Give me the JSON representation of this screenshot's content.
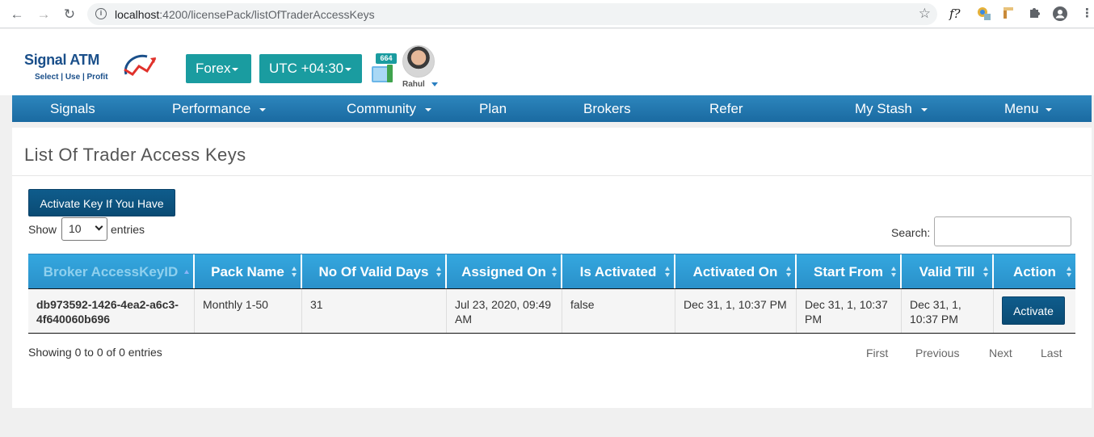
{
  "browser": {
    "url_host": "localhost",
    "url_rest": ":4200/licensePack/listOfTraderAccessKeys",
    "ext_font_label": "f?"
  },
  "brand": {
    "name_part1": "Signal",
    "name_part2": "ATM",
    "tagline": "Select | Use | Profit"
  },
  "header": {
    "market_label": "Forex",
    "timezone_label": "UTC +04:30",
    "coins_count": "664",
    "user_name": "Rahul"
  },
  "nav": {
    "items": [
      {
        "label": "Signals",
        "dropdown": false
      },
      {
        "label": "Performance",
        "dropdown": true
      },
      {
        "label": "Community",
        "dropdown": true
      },
      {
        "label": "Plan",
        "dropdown": false
      },
      {
        "label": "Brokers",
        "dropdown": false
      },
      {
        "label": "Refer",
        "dropdown": false
      },
      {
        "label": "My Stash",
        "dropdown": true
      },
      {
        "label": "Menu",
        "dropdown": true
      }
    ]
  },
  "main": {
    "title": "List Of Trader Access Keys",
    "activate_key_label": "Activate Key If You Have",
    "show_label": "Show",
    "show_value": "10",
    "entries_label": "entries",
    "search_label": "Search:",
    "columns": [
      "Broker AccessKeyID",
      "Pack Name",
      "No Of Valid Days",
      "Assigned On",
      "Is Activated",
      "Activated On",
      "Start From",
      "Valid Till",
      "Action"
    ],
    "rows": [
      {
        "key_id": "db973592-1426-4ea2-a6c3-4f640060b696",
        "pack_name": "Monthly 1-50",
        "valid_days": "31",
        "assigned_on": "Jul 23, 2020, 09:49 AM",
        "is_activated": "false",
        "activated_on": "Dec 31, 1, 10:37 PM",
        "start_from": "Dec 31, 1, 10:37 PM",
        "valid_till": "Dec 31, 1, 10:37 PM",
        "action_label": "Activate"
      }
    ],
    "info": "Showing 0 to 0 of 0 entries",
    "pager": {
      "first": "First",
      "previous": "Previous",
      "next": "Next",
      "last": "Last"
    }
  },
  "colors": {
    "teal": "#1a9ca0",
    "nav_blue": "#1a6aa1",
    "header_blue": "#2a90c9",
    "button_navy": "#0a4b74"
  }
}
